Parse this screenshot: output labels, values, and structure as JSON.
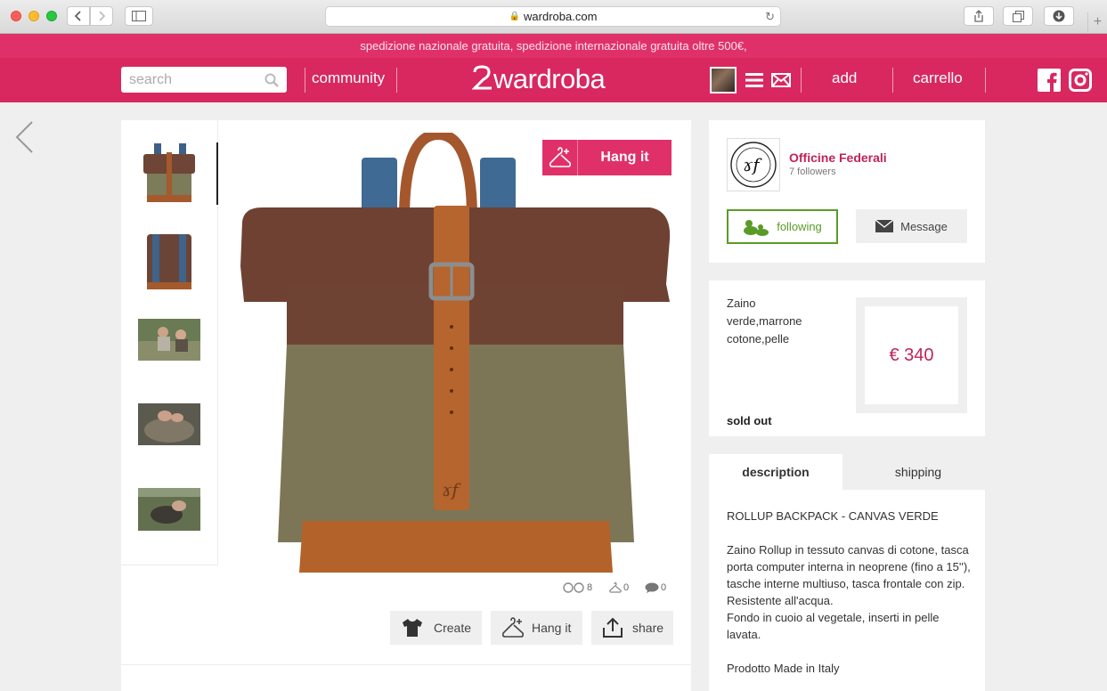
{
  "browser": {
    "url": "wardroba.com",
    "new_tab_symbol": "+"
  },
  "promo": {
    "text": "spedizione nazionale gratuita, spedizione internazionale gratuita oltre 500€,"
  },
  "nav": {
    "search_placeholder": "search",
    "community": "community",
    "logo": "wardroba",
    "add": "add",
    "cart": "carrello"
  },
  "product": {
    "hang_it_label": "Hang it",
    "stats": {
      "views": "8",
      "hangs": "0",
      "comments": "0"
    },
    "actions": {
      "create": "Create",
      "hang_it": "Hang it",
      "share": "share"
    }
  },
  "seller": {
    "name": "Officine Federali",
    "followers": "7 followers",
    "follow_label": "following",
    "message_label": "Message"
  },
  "details": {
    "lines": [
      "Zaino",
      "verde,marrone",
      "cotone,pelle"
    ],
    "price": "€ 340",
    "status": "sold out"
  },
  "tabs": {
    "description": "description",
    "shipping": "shipping"
  },
  "description": {
    "title": "ROLLUP BACKPACK - CANVAS VERDE",
    "body": "Zaino Rollup in tessuto canvas di cotone, tasca porta computer interna in neoprene (fino a 15''), tasche interne multiuso, tasca frontale con zip.",
    "line1": "Resistente all'acqua.",
    "line2": "Fondo in cuoio al vegetale, inserti in pelle lavata.",
    "made_in": "Prodotto Made in Italy"
  },
  "colors": {
    "brand_pink": "#e0306a",
    "nav_pink": "#d8285f",
    "follow_green": "#5a9b28"
  }
}
